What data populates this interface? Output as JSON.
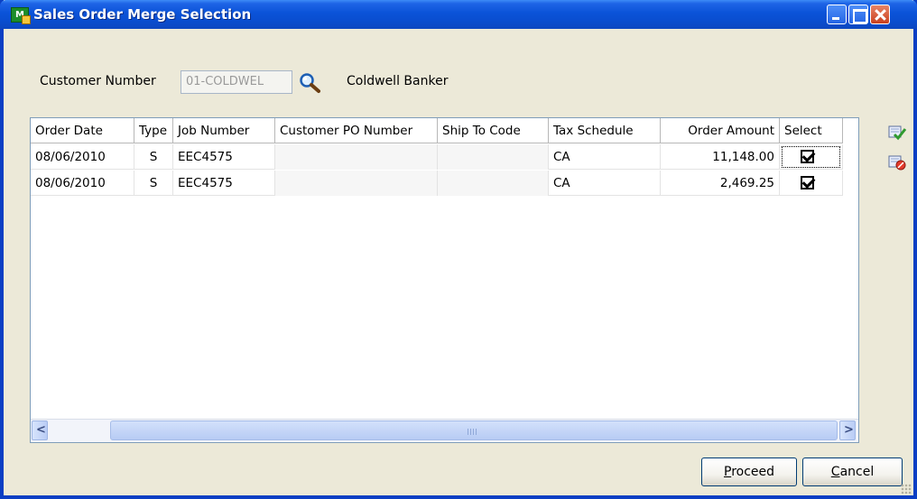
{
  "window": {
    "title": "Sales Order Merge Selection",
    "app_icon": "sage-mas-app-icon",
    "controls": [
      "minimize",
      "maximize",
      "close"
    ]
  },
  "customer": {
    "label": "Customer Number",
    "number": "01-COLDWEL",
    "lookup_icon": "magnifier-icon",
    "name": "Coldwell Banker"
  },
  "grid": {
    "columns": [
      "Order Date",
      "Type",
      "Job Number",
      "Customer PO Number",
      "Ship To Code",
      "Tax Schedule",
      "Order Amount",
      "Select"
    ],
    "rows": [
      {
        "order_date": "08/06/2010",
        "type": "S",
        "job_number": "EEC4575",
        "customer_po": "",
        "ship_to": "",
        "tax_schedule": "CA",
        "order_amount": "11,148.00",
        "selected": true
      },
      {
        "order_date": "08/06/2010",
        "type": "S",
        "job_number": "EEC4575",
        "customer_po": "",
        "ship_to": "",
        "tax_schedule": "CA",
        "order_amount": "2,469.25",
        "selected": true
      }
    ]
  },
  "side_tools": [
    "select-all-icon",
    "clear-all-icon"
  ],
  "buttons": {
    "proceed": {
      "accel": "P",
      "rest": "roceed"
    },
    "cancel": {
      "accel": "C",
      "rest": "ancel"
    }
  },
  "colors": {
    "titlebar": "#0a4ed0",
    "window_bg": "#ece9d8",
    "grid_border": "#7f9db9"
  }
}
